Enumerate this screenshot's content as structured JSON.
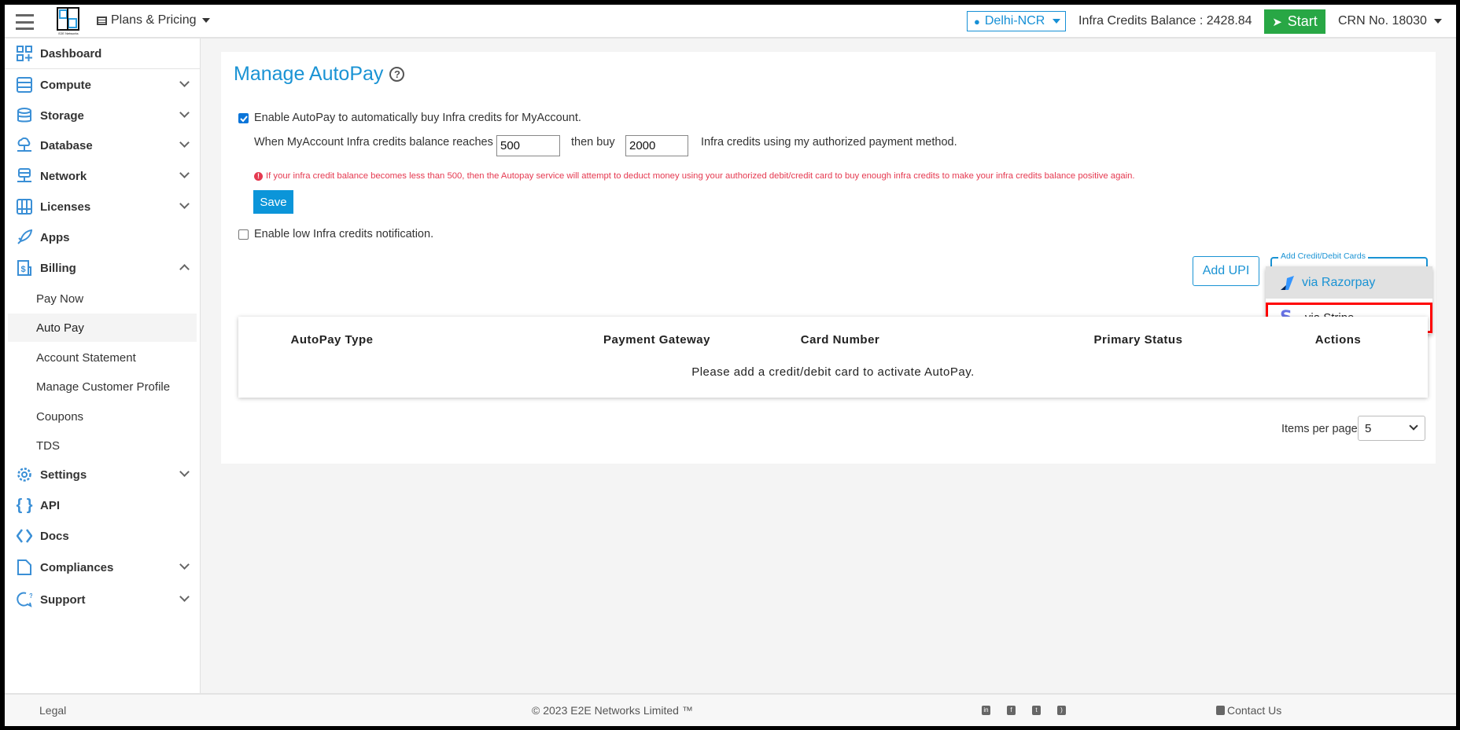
{
  "header": {
    "plans_label": "Plans & Pricing",
    "region": "Delhi-NCR",
    "credits_balance": "Infra Credits Balance : 2428.84",
    "start_label": "Start",
    "crn": "CRN No. 18030",
    "logo_text": "E2E Networks"
  },
  "sidebar": {
    "items": [
      {
        "label": "Dashboard",
        "icon": "dashboard-icon"
      },
      {
        "label": "Compute",
        "icon": "server-icon"
      },
      {
        "label": "Storage",
        "icon": "database-icon"
      },
      {
        "label": "Database",
        "icon": "cloud-icon"
      },
      {
        "label": "Network",
        "icon": "network-icon"
      },
      {
        "label": "Licenses",
        "icon": "grid-icon"
      },
      {
        "label": "Apps",
        "icon": "rocket-icon"
      },
      {
        "label": "Billing",
        "icon": "billing-icon"
      },
      {
        "label": "Settings",
        "icon": "gear-icon"
      },
      {
        "label": "API",
        "icon": "braces-icon"
      },
      {
        "label": "Docs",
        "icon": "code-icon"
      },
      {
        "label": "Compliances",
        "icon": "document-icon"
      },
      {
        "label": "Support",
        "icon": "support-icon"
      }
    ],
    "billing_sub": [
      "Pay Now",
      "Auto Pay",
      "Account Statement",
      "Manage Customer Profile",
      "Coupons",
      "TDS"
    ]
  },
  "main": {
    "title": "Manage AutoPay",
    "enable_autopay_label": "Enable AutoPay to automatically buy Infra credits for MyAccount.",
    "enable_autopay_checked": true,
    "when_label": "When MyAccount Infra credits balance reaches",
    "threshold_value": "500",
    "then_buy_label": "then buy",
    "buy_value": "2000",
    "using_label": "Infra credits using my authorized payment method.",
    "warning": "If your infra credit balance becomes less than 500, then the Autopay service will attempt to deduct money using your authorized debit/credit card to buy enough infra credits to make your infra credits balance positive again.",
    "save_label": "Save",
    "low_notification_label": "Enable low Infra credits notification.",
    "low_notification_checked": false,
    "add_upi_label": "Add UPI",
    "add_cards_legend": "Add Credit/Debit Cards",
    "card_options": [
      "via Razorpay",
      "via Stripe"
    ],
    "table": {
      "headers": [
        "AutoPay Type",
        "Payment Gateway",
        "Card Number",
        "Primary Status",
        "Actions"
      ],
      "empty_message": "Please add a credit/debit card to activate AutoPay."
    },
    "items_per_page_label": "Items per page",
    "items_per_page_value": "5"
  },
  "footer": {
    "legal": "Legal",
    "copyright": "© 2023 E2E Networks Limited ™",
    "social": [
      "linkedin-icon",
      "facebook-icon",
      "twitter-icon",
      "rss-icon"
    ],
    "contact": "Contact Us"
  },
  "colors": {
    "accent": "#0b95d9",
    "start": "#28a745",
    "warning": "#e53950",
    "highlight": "#ff0000"
  }
}
